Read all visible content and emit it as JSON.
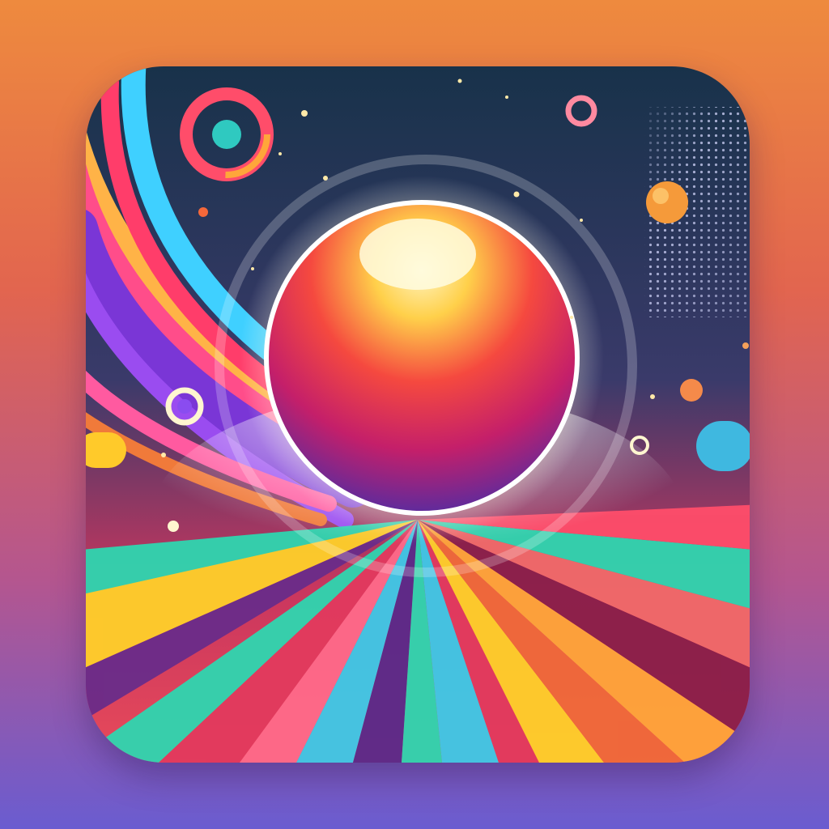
{
  "icon": {
    "name": "app-icon-glowing-orb",
    "colors": {
      "page_top": "#ee8a3e",
      "page_bottom": "#6a5cd0",
      "sky_top": "#18324a",
      "sky_bottom": "#c9365e",
      "orb_highlight": "#fff4c0",
      "orb_mid": "#f5493f",
      "orb_shadow": "#3a2fae",
      "glow": "#ffffff"
    },
    "rays": [
      "#e23a5e",
      "#ffd02a",
      "#2fd6b0",
      "#3ec9e8",
      "#f06a3a",
      "#7a3ac9"
    ],
    "swoosh": [
      "#ff4d8a",
      "#3fd0ff",
      "#7a36d6",
      "#ffa63a"
    ]
  }
}
